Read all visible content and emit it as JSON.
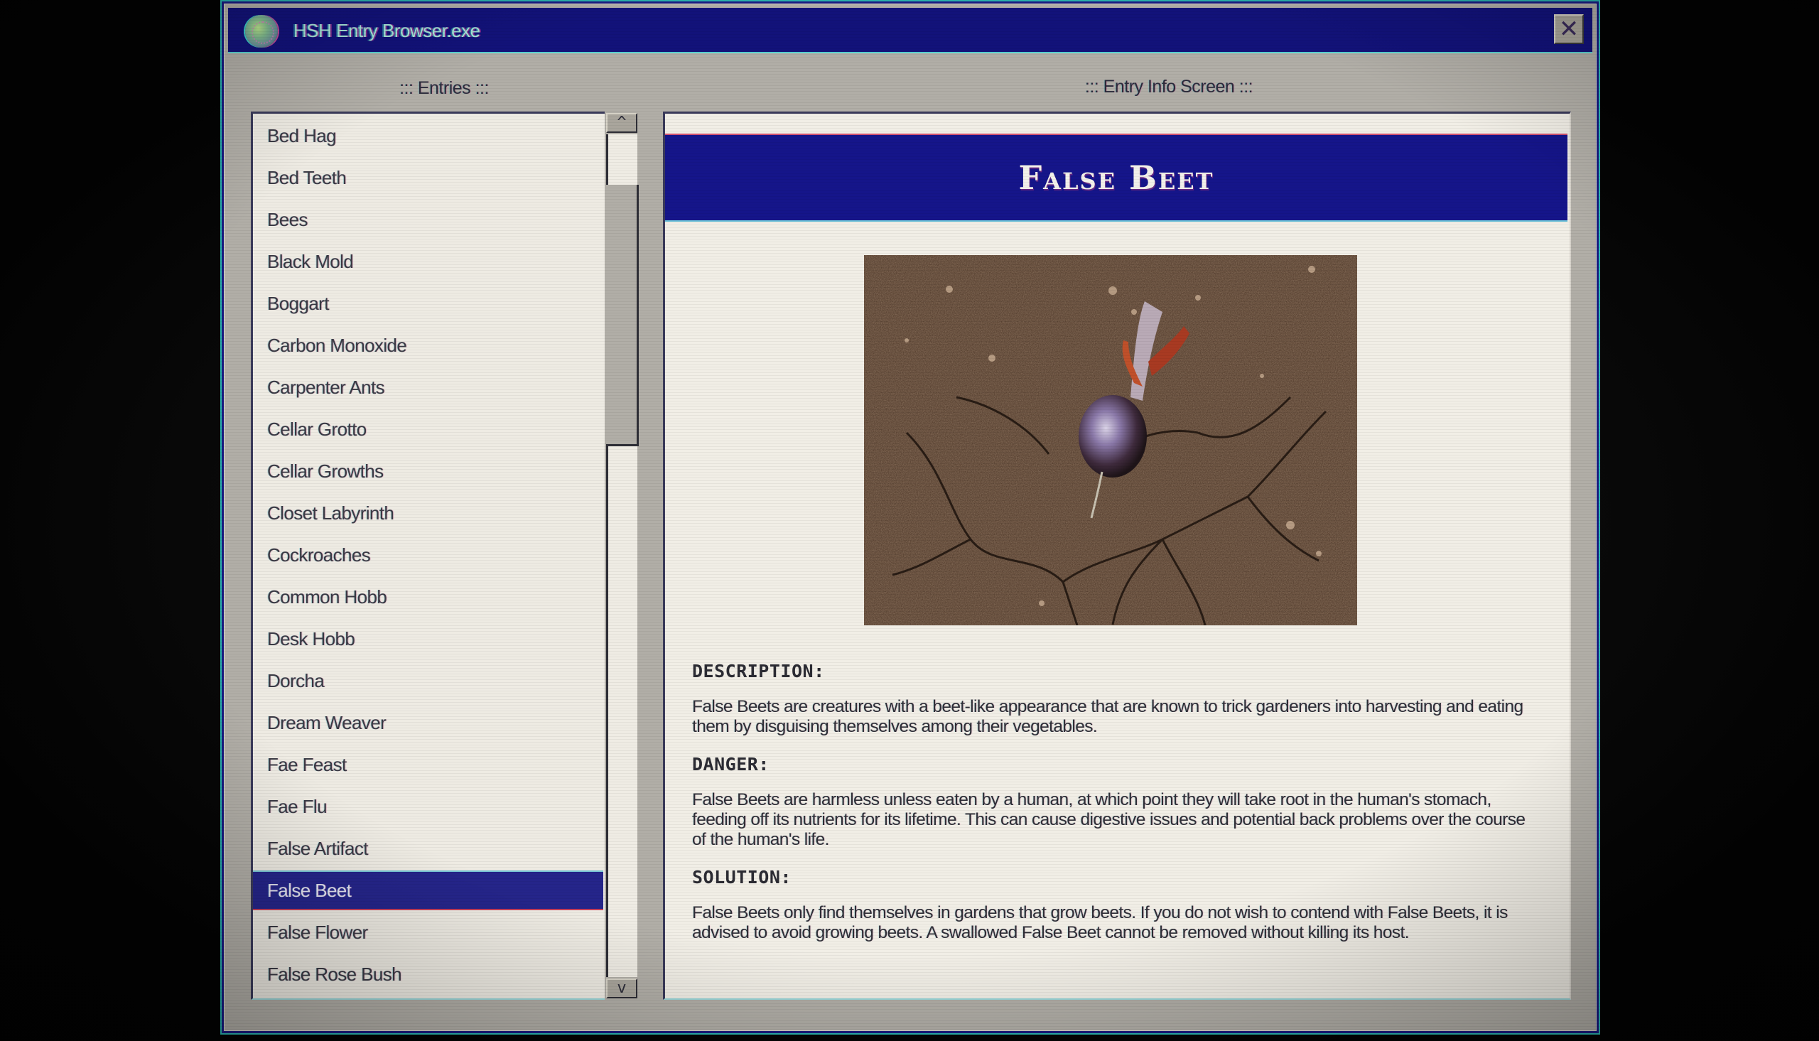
{
  "window": {
    "title": "HSH Entry Browser.exe",
    "logo_icon": "globe-emblem-icon",
    "close_icon": "close-x-icon",
    "close_glyph": "✕"
  },
  "entries_panel": {
    "label": "::: Entries :::",
    "items": [
      {
        "label": "Bed Hag",
        "selected": false
      },
      {
        "label": "Bed Teeth",
        "selected": false
      },
      {
        "label": "Bees",
        "selected": false
      },
      {
        "label": "Black Mold",
        "selected": false
      },
      {
        "label": "Boggart",
        "selected": false
      },
      {
        "label": "Carbon Monoxide",
        "selected": false
      },
      {
        "label": "Carpenter Ants",
        "selected": false
      },
      {
        "label": "Cellar Grotto",
        "selected": false
      },
      {
        "label": "Cellar Growths",
        "selected": false
      },
      {
        "label": "Closet Labyrinth",
        "selected": false
      },
      {
        "label": "Cockroaches",
        "selected": false
      },
      {
        "label": "Common Hobb",
        "selected": false
      },
      {
        "label": "Desk Hobb",
        "selected": false
      },
      {
        "label": "Dorcha",
        "selected": false
      },
      {
        "label": "Dream Weaver",
        "selected": false
      },
      {
        "label": "Fae Feast",
        "selected": false
      },
      {
        "label": "Fae Flu",
        "selected": false
      },
      {
        "label": "False Artifact",
        "selected": false
      },
      {
        "label": "False Beet",
        "selected": true
      },
      {
        "label": "False Flower",
        "selected": false
      },
      {
        "label": "False Rose Bush",
        "selected": false
      }
    ],
    "scrollbar": {
      "up_glyph": "^",
      "down_glyph": "v",
      "thumb_position_fraction": 0.06,
      "thumb_size_fraction": 0.31
    }
  },
  "info_panel": {
    "label": "::: Entry Info Screen :::",
    "entry_title": "False Beet",
    "image_description": "beet-in-cracked-soil-photo",
    "sections": [
      {
        "heading": "DESCRIPTION:",
        "text": "False Beets are creatures with a beet-like appearance that are known to trick gardeners into harvesting and eating them by disguising themselves among their vegetables."
      },
      {
        "heading": "DANGER:",
        "text": "False Beets are harmless unless eaten by a human, at which point they will take root in the human's stomach, feeding off its nutrients for its lifetime. This can cause digestive issues and potential back problems over the course of the human's life."
      },
      {
        "heading": "SOLUTION:",
        "text": "False Beets only find themselves in gardens that grow beets. If you do not wish to contend with False Beets, it is advised to avoid growing beets. A swallowed False Beet cannot be removed without killing its host."
      }
    ]
  },
  "colors": {
    "titlebar": "#12127a",
    "selection": "#25258a",
    "banner": "#15158a",
    "window_bg": "#b1aea7",
    "panel_bg": "#f1eee6"
  }
}
